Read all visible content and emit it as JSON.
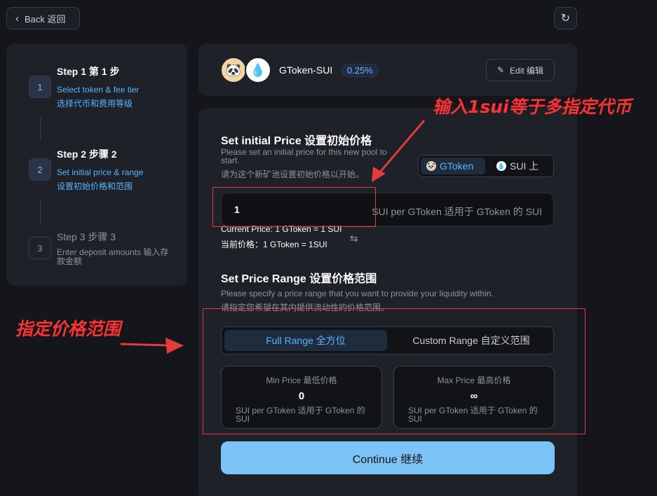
{
  "nav": {
    "back_label": "Back  返回"
  },
  "steps": [
    {
      "number": "1",
      "title": "Step  1  第 1 步",
      "subtitle": "Select token & fee tier\n选择代币和费用等级"
    },
    {
      "number": "2",
      "title": "Step  2  步骤 2",
      "subtitle": "Set initial price & range\n设置初始价格和范围"
    },
    {
      "number": "3",
      "title": "Step  3  步骤 3",
      "subtitle": "Enter deposit amounts  输入存款金额"
    }
  ],
  "pool": {
    "pair": "GToken-SUI",
    "fee": "0.25%",
    "edit_label": "Edit  编辑"
  },
  "initial_price": {
    "title": "Set initial Price  设置初始价格",
    "desc_en": "Please set an initial price for this new pool to start.",
    "desc_zh": "请为这个新矿池设置初始价格以开始。",
    "toggle_a": "GToken",
    "toggle_b": "SUI  上",
    "value": "1",
    "unit": "SUI per GToken  适用于 GToken 的 SUI",
    "current_en": "Current Price: 1 GToken = 1 SUI",
    "current_zh": "当前价格：1 GToken = 1SUI"
  },
  "price_range": {
    "title": "Set Price Range  设置价格范围",
    "desc_en": "Please specify a price range that you want to provide your liquidity within.",
    "desc_zh": "请指定您希望在其内提供流动性的价格范围。",
    "full_label": "Full Range  全方位",
    "custom_label": "Custom Range  自定义范围",
    "min_label": "Min Price  最低价格",
    "min_value": "0",
    "max_label": "Max Price  最高价格",
    "max_value": "∞",
    "unit": "SUI per GToken  适用于 GToken 的 SUI"
  },
  "continue_label": "Continue  继续",
  "annotations": {
    "top": "输入1sui等于多指定代币",
    "left": "指定价格范围",
    "color": "#ff3333"
  },
  "colors": {
    "accent": "#58b4ff",
    "button": "#7cc3f7",
    "background": "#14161b",
    "panel": "#1e2128"
  }
}
